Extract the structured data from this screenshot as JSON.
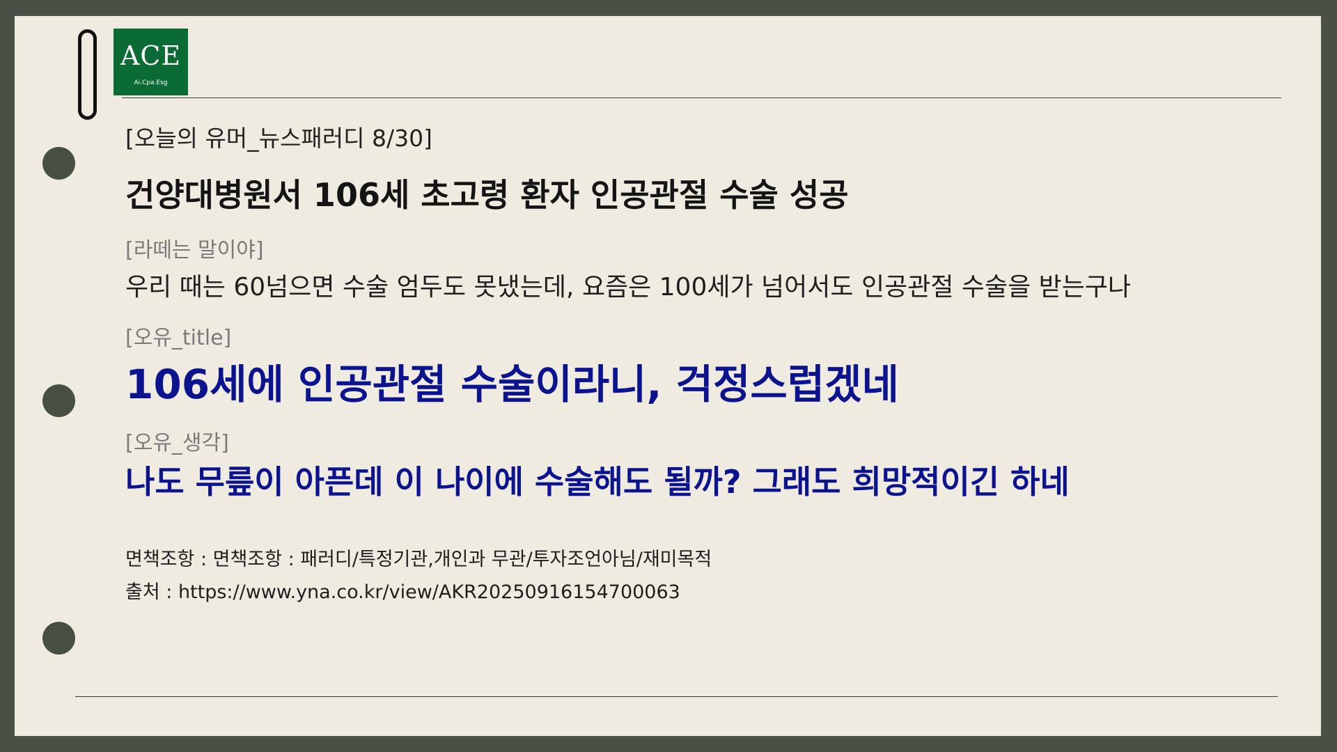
{
  "logo": {
    "main": "ACE",
    "sub": "Ai.Cpa.Esg"
  },
  "header": "[오늘의 유머_뉴스패러디 8/30]",
  "headline": "건양대병원서 106세 초고령 환자 인공관절 수술 성공",
  "latte": {
    "label": "[라떼는 말이야]",
    "text": "우리 때는 60넘으면 수술 엄두도 못냈는데, 요즘은 100세가 넘어서도 인공관절 수술을 받는구나"
  },
  "title": {
    "label": "[오유_title]",
    "text": "106세에 인공관절 수술이라니, 걱정스럽겠네"
  },
  "thought": {
    "label": "[오유_생각]",
    "text": "나도 무릎이 아픈데 이 나이에 수술해도 될까? 그래도 희망적이긴 하네"
  },
  "disclaimer": "면책조항 : 면책조항 : 패러디/특정기관,개인과 무관/투자조언아님/재미목적",
  "source": "출처 : https://www.yna.co.kr/view/AKR20250916154700063",
  "colors": {
    "background": "#4a5046",
    "paper": "#f0ebe1",
    "logo": "#0a6b34",
    "accent": "#0c138f"
  }
}
